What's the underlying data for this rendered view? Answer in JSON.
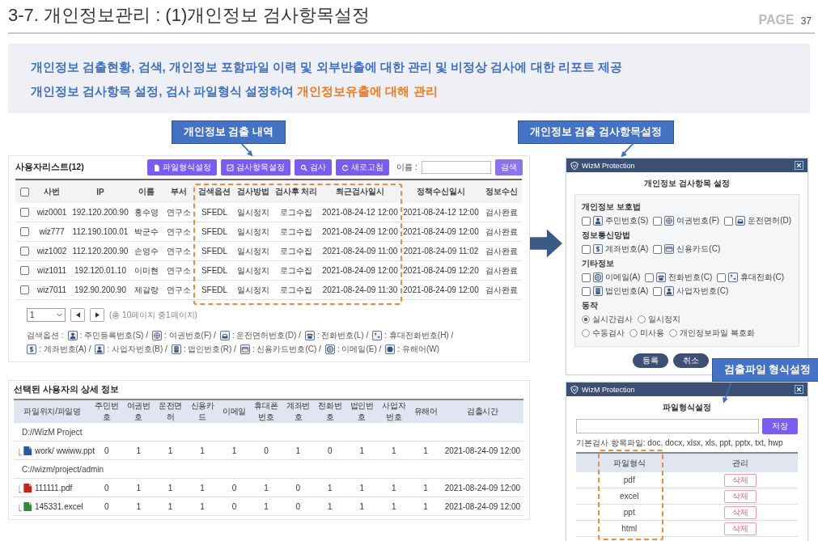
{
  "header": {
    "title": "3-7. 개인정보관리 : (1)개인정보 검사항목설정",
    "page_label": "PAGE",
    "page_number": "37"
  },
  "summary": {
    "line_1": "개인정보 검출현황, 검색, 개인정보 포함파일 이력 및 외부반출에 대한 관리 및 비정상 검사에 대한 리포트 제공",
    "line_2": [
      {
        "text": "개인정보 검사항목 설정, 검사 파일형식 설정하여 ",
        "highlight": false
      },
      {
        "text": "개인정보유출에 대해 관리",
        "highlight": true
      }
    ]
  },
  "callouts": [
    "개인정보 검출 내역",
    "개인정보 검출 검사항목설정",
    "검출파일 형식설정"
  ],
  "user_list": {
    "title": "사용자리스트(12)",
    "toolbar": [
      "파일형식설정",
      "검사항목설정",
      "검사",
      "새로고침"
    ],
    "name_label": "이름 :",
    "search_button": "검색",
    "header_checked": false,
    "columns": [
      "사번",
      "IP",
      "이름",
      "부서",
      "검색옵션",
      "검사방법",
      "검사후 처리",
      "최근검사일시",
      "정책수신일시",
      "정보수신"
    ],
    "rows": [
      {
        "checked": false,
        "cells": [
          "wiz0001",
          "192.120.200.90",
          "홍수영",
          "연구소",
          "SFEDL",
          "일시정지",
          "로그수집",
          "2021-08-24-12 12:00",
          "2021-08-24-12 12:00",
          "검사완료"
        ]
      },
      {
        "checked": false,
        "cells": [
          "wiz777",
          "112.190.100.01",
          "박군수",
          "연구소",
          "SFEDL",
          "일시정지",
          "로그수집",
          "2021-08-24-09 12:00",
          "2021-08-24-09 12:00",
          "검사완료"
        ]
      },
      {
        "checked": false,
        "cells": [
          "wiz1002",
          "112.120.200.90",
          "손영수",
          "연구소",
          "SFEDL",
          "일시정지",
          "로그수집",
          "2021-08-24-09 11:00",
          "2021-08-24-09 11:02",
          "검사완료"
        ]
      },
      {
        "checked": false,
        "cells": [
          "wiz1011",
          "192.120.01.10",
          "이미현",
          "연구소",
          "SFEDL",
          "일시정지",
          "로그수집",
          "2021-08-24-09 12:00",
          "2021-08-24-09 12:20",
          "검사완료"
        ]
      },
      {
        "checked": false,
        "cells": [
          "wiz7011",
          "192.90.200.90",
          "제갈량",
          "연구소",
          "SFEDL",
          "일시정지",
          "로그수집",
          "2021-08-24-09 11:30",
          "2021-08-24-09 12:00",
          "검사완료"
        ]
      }
    ],
    "page_select": "1",
    "page_info": "(총 10페이지 중1페이지)",
    "legend_label": "검색옵션 :",
    "legend": [
      ": 주민등록번호(S) /",
      ": 여권번호(F) /",
      ": 운전면허번호(D) /",
      ": 전화번호(L) /",
      ": 휴대전화번호(H) /",
      ": 계좌번호(A) /",
      ": 사업자번호(B) /",
      ": 법인번호(R) /",
      ": 신용카드번호(C) /",
      ": 이메일(E) /",
      ": 유해어(W)"
    ]
  },
  "detail": {
    "title": "선택된 사용자의 상세 정보",
    "columns": [
      "파일위치/파일명",
      "주민번호",
      "여권번호",
      "운전면허",
      "신용카드",
      "이메일",
      "휴대폰번호",
      "계좌번호",
      "전화번호",
      "법인번호",
      "사업자번호",
      "유해어",
      "검출시간"
    ],
    "rows": [
      {
        "kind": "folder",
        "path": "D://WizM Project"
      },
      {
        "kind": "word",
        "name": "work/ wwiww.ppt",
        "cells": [
          "0",
          "1",
          "1",
          "1",
          "1",
          "0",
          "1",
          "0",
          "1",
          "1",
          "1"
        ],
        "time": "2021-08-24-09 12:00"
      },
      {
        "kind": "folder",
        "path": "C://wizm/project/admin"
      },
      {
        "kind": "pdf",
        "name": "111111.pdf",
        "cells": [
          "0",
          "1",
          "1",
          "1",
          "0",
          "1",
          "0",
          "1",
          "1",
          "1",
          "1"
        ],
        "time": "2021-08-24-09 12:00"
      },
      {
        "kind": "excel",
        "name": "145331.excel",
        "cells": [
          "0",
          "1",
          "1",
          "1",
          "0",
          "1",
          "0",
          "1",
          "1",
          "1",
          "1"
        ],
        "time": "2021-08-24-09 12:00"
      }
    ]
  },
  "item_dialog": {
    "brand": "WizM Protection",
    "title": "개인정보 검사항목 설정",
    "groups": [
      {
        "heading": "개인정보 보호법",
        "rows": [
          {
            "items": [
              {
                "label": "주민번호(S)",
                "checked": false
              },
              {
                "label": "여권번호(F)",
                "checked": false
              },
              {
                "label": "운전면허(D)",
                "checked": false
              }
            ]
          }
        ]
      },
      {
        "heading": "정보통신망법",
        "rows": [
          {
            "items": [
              {
                "label": "계좌번호(A)",
                "checked": false
              },
              {
                "label": "신용카드(C)",
                "checked": false
              }
            ]
          }
        ]
      },
      {
        "heading": "기타정보",
        "rows": [
          {
            "items": [
              {
                "label": "이메일(A)",
                "checked": false
              },
              {
                "label": "전화번호(C)",
                "checked": false
              },
              {
                "label": "휴대전화(C)",
                "checked": false
              }
            ]
          },
          {
            "items": [
              {
                "label": "법인번호(A)",
                "checked": false
              },
              {
                "label": "사업자번호(C)",
                "checked": false
              }
            ]
          }
        ]
      }
    ],
    "action_heading": "동작",
    "action_rows": [
      {
        "options": [
          {
            "label": "실시간검사",
            "selected": true
          },
          {
            "label": "일시정지",
            "selected": false
          }
        ]
      },
      {
        "options": [
          {
            "label": "수동검사",
            "selected": false
          },
          {
            "label": "미사용",
            "selected": false
          },
          {
            "label": "개인정보파일 복호화",
            "selected": false
          }
        ]
      }
    ],
    "buttons": [
      "등록",
      "취소"
    ]
  },
  "format_dialog": {
    "brand": "WizM Protection",
    "title": "파일형식설정",
    "save_button": "저장",
    "info": "기본검사 항목파일: doc, docx, xlsx, xls, ppt, pptx, txt, hwp",
    "columns": [
      "파일형식",
      "관리"
    ],
    "rows": [
      {
        "format": "pdf",
        "action": "삭제"
      },
      {
        "format": "excel",
        "action": "삭제"
      },
      {
        "format": "ppt",
        "action": "삭제"
      },
      {
        "format": "html",
        "action": "삭제"
      }
    ]
  }
}
